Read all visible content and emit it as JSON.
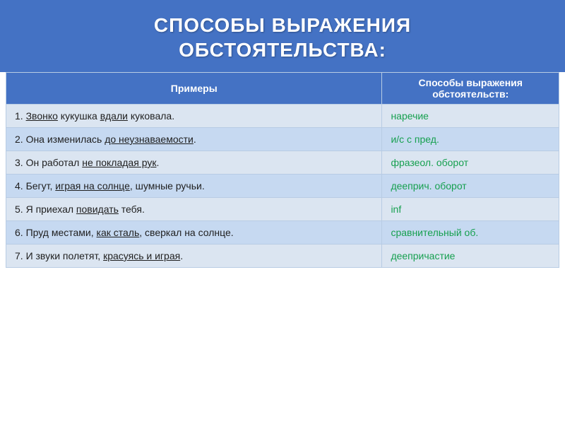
{
  "header": {
    "title_line1": "СПОСОБЫ ВЫРАЖЕНИЯ",
    "title_line2": "ОБСТОЯТЕЛЬСТВА:"
  },
  "table": {
    "col_examples_header": "Примеры",
    "col_ways_header": "Способы выражения обстоятельств:",
    "rows": [
      {
        "example_parts": [
          {
            "text": "1.  ",
            "underline": false
          },
          {
            "text": "Звонко",
            "underline": true
          },
          {
            "text": " кукушка ",
            "underline": false
          },
          {
            "text": "вдали",
            "underline": true
          },
          {
            "text": " куковала.",
            "underline": false
          }
        ],
        "way": "наречие"
      },
      {
        "example_parts": [
          {
            "text": "2.  Она изменилась ",
            "underline": false
          },
          {
            "text": "до неузнаваемости",
            "underline": true
          },
          {
            "text": ".",
            "underline": false
          }
        ],
        "way": "и/с  с пред."
      },
      {
        "example_parts": [
          {
            "text": "3. Он работал ",
            "underline": false
          },
          {
            "text": "не покладая рук",
            "underline": true
          },
          {
            "text": ".",
            "underline": false
          }
        ],
        "way": "фразеол. оборот"
      },
      {
        "example_parts": [
          {
            "text": "4. Бегут, ",
            "underline": false
          },
          {
            "text": "играя на солнце",
            "underline": true
          },
          {
            "text": ", шумные ручьи.",
            "underline": false
          }
        ],
        "way": "дееприч. оборот"
      },
      {
        "example_parts": [
          {
            "text": "5.  Я приехал ",
            "underline": false
          },
          {
            "text": "повидать",
            "underline": true
          },
          {
            "text": " тебя.",
            "underline": false
          }
        ],
        "way": "inf"
      },
      {
        "example_parts": [
          {
            "text": "6.  Пруд местами, ",
            "underline": false
          },
          {
            "text": "как сталь",
            "underline": true
          },
          {
            "text": ", сверкал на солнце.",
            "underline": false
          }
        ],
        "way": "сравнительный об."
      },
      {
        "example_parts": [
          {
            "text": "7.  И звуки полетят, ",
            "underline": false
          },
          {
            "text": "красуясь и играя",
            "underline": true
          },
          {
            "text": ".",
            "underline": false
          }
        ],
        "way": "деепричастие"
      }
    ]
  }
}
